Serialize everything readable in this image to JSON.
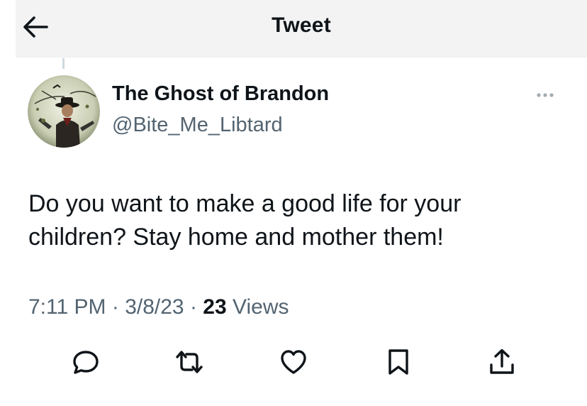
{
  "header": {
    "title": "Tweet",
    "back_icon": "arrow-left-icon"
  },
  "author": {
    "display_name": "The Ghost of Brandon",
    "handle": "@Bite_Me_Libtard",
    "avatar": "avatar-image"
  },
  "tweet": {
    "text": "Do you want to make a good life for your children? Stay home and mother them!",
    "time": "7:11 PM",
    "date": "3/8/23",
    "separator": "·",
    "views_count": "23",
    "views_label": "Views"
  },
  "actions": [
    {
      "name": "reply",
      "icon": "reply-icon"
    },
    {
      "name": "retweet",
      "icon": "retweet-icon"
    },
    {
      "name": "like",
      "icon": "heart-icon"
    },
    {
      "name": "bookmark",
      "icon": "bookmark-icon"
    },
    {
      "name": "share",
      "icon": "share-icon"
    }
  ],
  "colors": {
    "text": "#0f1419",
    "secondary": "#536471",
    "header_bg": "#f3f3f4"
  }
}
